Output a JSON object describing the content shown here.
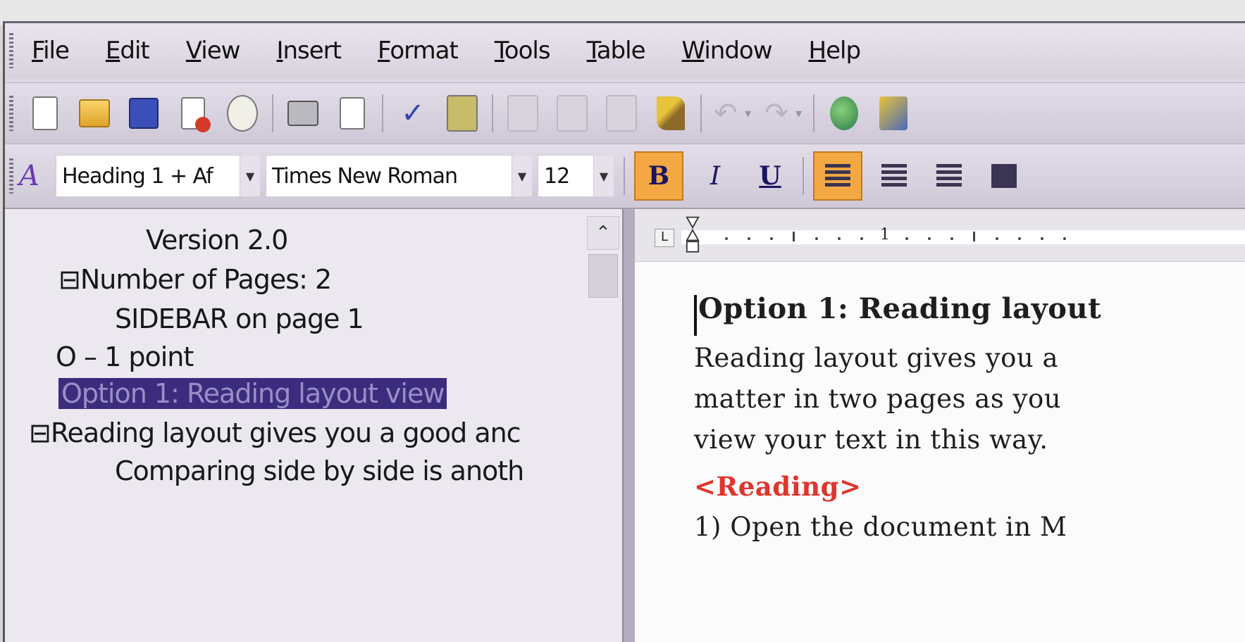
{
  "menu": [
    "File",
    "Edit",
    "View",
    "Insert",
    "Format",
    "Tools",
    "Table",
    "Window",
    "Help"
  ],
  "standard_toolbar": {
    "icons": [
      "new-document-icon",
      "open-folder-icon",
      "save-icon",
      "permission-icon",
      "email-icon",
      "print-icon",
      "print-preview-icon",
      "spelling-icon",
      "research-icon",
      "cut-icon",
      "copy-icon",
      "paste-icon",
      "format-painter-icon",
      "undo-icon",
      "redo-icon",
      "hyperlink-icon",
      "tables-borders-icon"
    ]
  },
  "formatting_toolbar": {
    "style": "Heading 1 + Af",
    "font": "Times New Roman",
    "size": "12",
    "bold_label": "B",
    "italic_label": "I",
    "underline_label": "U",
    "bold_active": true,
    "align_left_active": true
  },
  "navigation_pane": {
    "items": [
      {
        "text": "Version 2.0"
      },
      {
        "text": "⊟Number of Pages: 2"
      },
      {
        "text": "SIDEBAR on page 1"
      },
      {
        "text": "O – 1 point"
      },
      {
        "text": "Option 1: Reading layout view",
        "selected": true
      },
      {
        "text": "⊟Reading layout gives you a good anc"
      },
      {
        "text": "Comparing side by side is anoth"
      }
    ]
  },
  "ruler": {
    "tab_marker": "L",
    "number": "1"
  },
  "document": {
    "heading": "Option 1: Reading layout",
    "body_lines": [
      "Reading layout gives you a",
      "matter in two pages as you",
      "view your text in this way."
    ],
    "tag": "<Reading>",
    "step": "1) Open the document in M"
  },
  "colors": {
    "selection_bg": "#3b2c7e",
    "active_button": "#f4a844",
    "tag_red": "#e0342c"
  }
}
